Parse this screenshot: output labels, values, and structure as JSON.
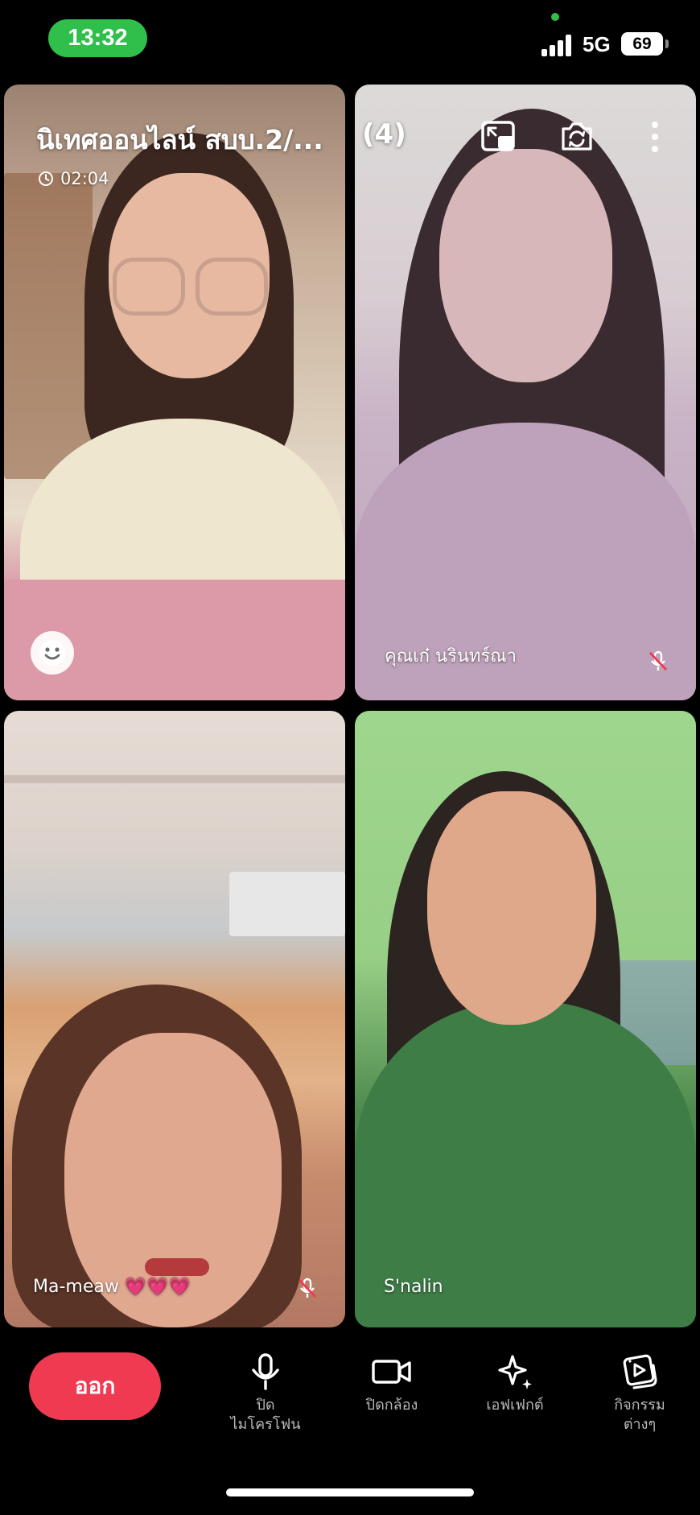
{
  "status_bar": {
    "time": "13:32",
    "network": "5G",
    "battery": "69",
    "time_color": "#2fbf4a"
  },
  "call": {
    "title": "นิเทศออนไลน์ สบบ.2/...",
    "participant_count": "(4)",
    "duration": "02:04"
  },
  "participants": [
    {
      "name": "",
      "muted": false,
      "is_self": true
    },
    {
      "name": "คุณเก๋ นรินทร์ณา",
      "muted": true
    },
    {
      "name": "Ma-meaw 💗💗💗",
      "muted": true
    },
    {
      "name": "S'nalin",
      "muted": false
    }
  ],
  "controls": {
    "leave_label": "ออก",
    "leave_color": "#f03a52",
    "mic_label": "ปิด\nไมโครโฟน",
    "camera_label": "ปิดกล้อง",
    "effects_label": "เอฟเฟกต์",
    "activities_label": "กิจกรรม\nต่างๆ"
  },
  "icons": {
    "header": [
      "pip-icon",
      "switch-camera-icon",
      "more-icon"
    ],
    "controls": [
      "microphone-icon",
      "video-camera-icon",
      "sparkles-icon",
      "activities-play-icon"
    ]
  }
}
